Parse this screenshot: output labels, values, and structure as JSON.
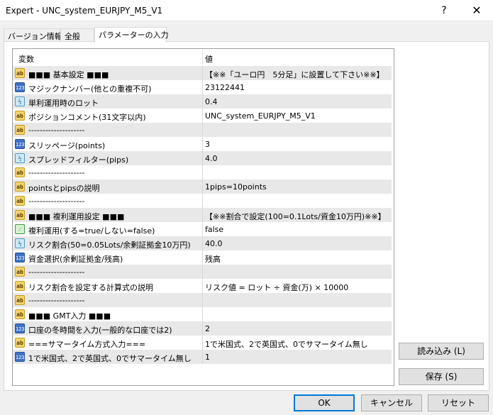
{
  "window": {
    "title": "Expert - UNC_system_EURJPY_M5_V1",
    "help": "?",
    "close": "✕"
  },
  "tabs": [
    "バージョン情報",
    "全般",
    "パラメーターの入力"
  ],
  "grid": {
    "col_variable": "変数",
    "col_value": "値",
    "rows": [
      {
        "icon": "ab",
        "name": "■■■ 基本設定 ■■■",
        "value": "【※※「ユーロ円　5分足」に設置して下さい※※】"
      },
      {
        "icon": "123",
        "name": "マジックナンバー(他との重複不可)",
        "value": "23122441"
      },
      {
        "icon": "half",
        "name": "単利運用時のロット",
        "value": "0.4"
      },
      {
        "icon": "ab",
        "name": "ポジションコメント(31文字以内)",
        "value": "UNC_system_EURJPY_M5_V1"
      },
      {
        "icon": "ab",
        "name": "--------------------",
        "value": ""
      },
      {
        "icon": "123",
        "name": "スリッページ(points)",
        "value": "3"
      },
      {
        "icon": "half",
        "name": "スプレッドフィルター(pips)",
        "value": "4.0"
      },
      {
        "icon": "ab",
        "name": "--------------------",
        "value": ""
      },
      {
        "icon": "ab",
        "name": "pointsとpipsの説明",
        "value": "1pips=10points"
      },
      {
        "icon": "ab",
        "name": "--------------------",
        "value": ""
      },
      {
        "icon": "ab",
        "name": "■■■ 複利運用設定 ■■■",
        "value": "【※※割合で設定(100=0.1Lots/資金10万円)※※】"
      },
      {
        "icon": "bool",
        "name": "複利運用(する=true/しない=false)",
        "value": "false"
      },
      {
        "icon": "half",
        "name": "リスク割合(50=0.05Lots/余剰証拠金10万円)",
        "value": "40.0"
      },
      {
        "icon": "123",
        "name": "資金選択(余剰証拠金/残高)",
        "value": "残高"
      },
      {
        "icon": "ab",
        "name": "--------------------",
        "value": ""
      },
      {
        "icon": "ab",
        "name": "リスク割合を設定する計算式の説明",
        "value": "リスク値 = ロット ÷ 資金(万) × 10000"
      },
      {
        "icon": "ab",
        "name": "--------------------",
        "value": ""
      },
      {
        "icon": "ab",
        "name": "■■■ GMT入力 ■■■",
        "value": ""
      },
      {
        "icon": "123",
        "name": "口座の冬時間を入力(一般的な口座では2)",
        "value": "2"
      },
      {
        "icon": "ab",
        "name": "===サマータイム方式入力===",
        "value": "1で米国式、2で英国式、0でサマータイム無し"
      },
      {
        "icon": "123",
        "name": "1で米国式、2で英国式、0でサマータイム無し",
        "value": "1"
      }
    ]
  },
  "buttons": {
    "load": "読み込み (L)",
    "save": "保存 (S)",
    "ok": "OK",
    "cancel": "キャンセル",
    "reset": "リセット"
  },
  "icon_names": {
    "ab": "string-param-icon",
    "123": "integer-param-icon",
    "half": "double-param-icon",
    "bool": "bool-param-icon"
  },
  "colors": {
    "row_alt": "#e8e8e8",
    "default_button_border": "#0078d7"
  }
}
